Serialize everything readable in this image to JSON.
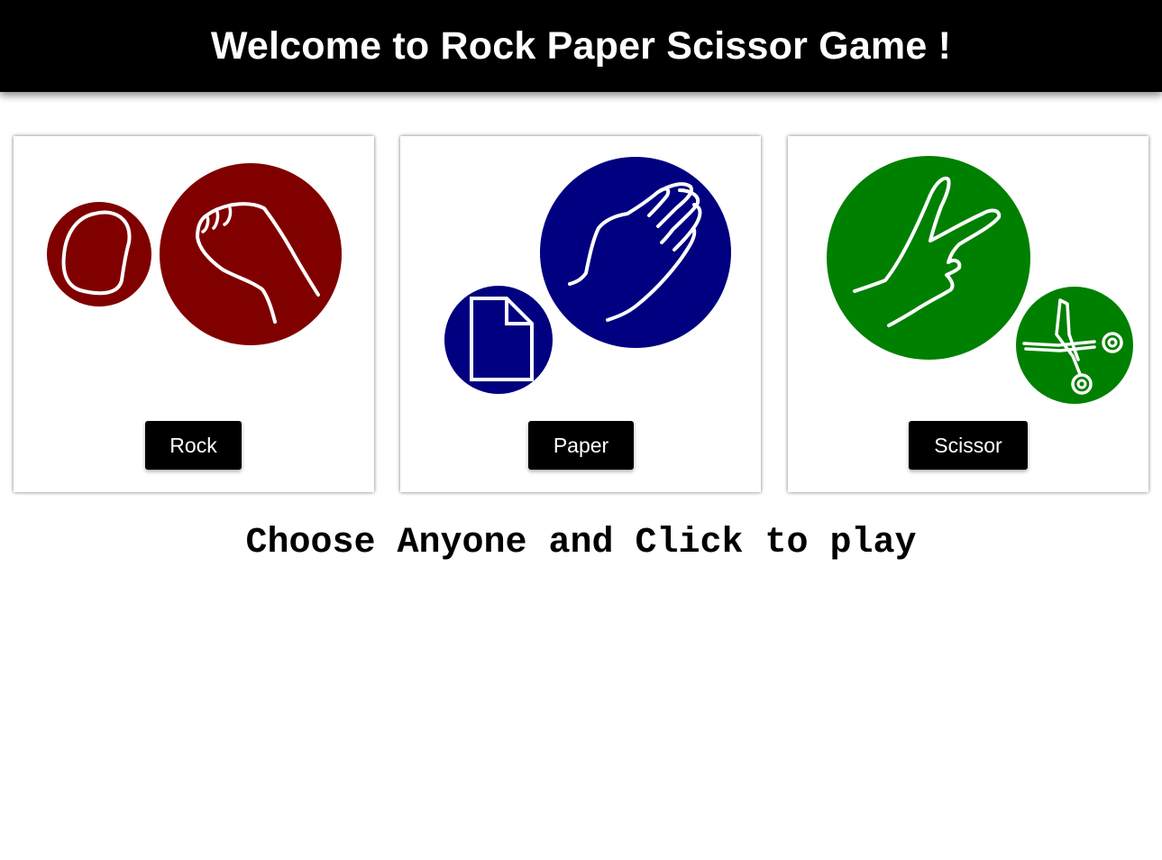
{
  "header": {
    "title": "Welcome to Rock Paper Scissor Game !"
  },
  "cards": [
    {
      "label": "Rock",
      "color": "#800000",
      "icons": [
        "rock-icon",
        "fist-icon"
      ]
    },
    {
      "label": "Paper",
      "color": "#000080",
      "icons": [
        "document-icon",
        "open-hand-icon"
      ]
    },
    {
      "label": "Scissor",
      "color": "#008000",
      "icons": [
        "victory-hand-icon",
        "scissors-icon"
      ]
    }
  ],
  "prompt": "Choose Anyone and Click to play"
}
